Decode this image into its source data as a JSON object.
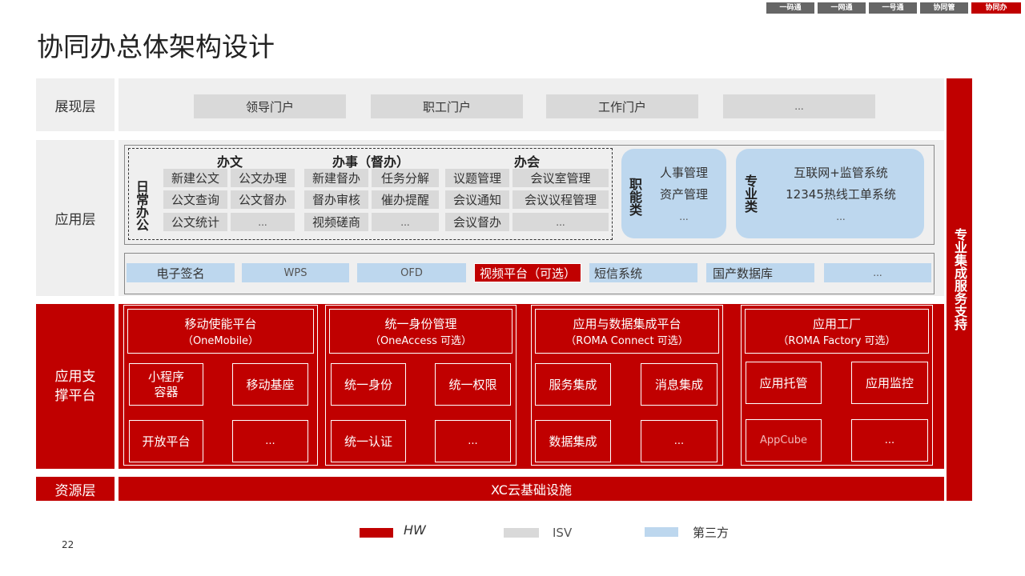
{
  "nav": [
    "一码通",
    "一网通",
    "一号通",
    "协同管",
    "协同办"
  ],
  "title": "协同办总体架构设计",
  "page_number": "22",
  "layers": {
    "presentation": "展现层",
    "application": "应用层",
    "support": "应用支撑平台",
    "resource": "资源层"
  },
  "portals": [
    "领导门户",
    "职工门户",
    "工作门户",
    "..."
  ],
  "daily_office": {
    "label": "日常办公",
    "groups": [
      {
        "header": "办文",
        "items": [
          "新建公文",
          "公文办理",
          "公文查询",
          "公文督办",
          "公文统计",
          "..."
        ]
      },
      {
        "header": "办事（督办）",
        "items": [
          "新建督办",
          "任务分解",
          "督办审核",
          "催办提醒",
          "视频磋商",
          "..."
        ]
      },
      {
        "header": "办会",
        "items": [
          "议题管理",
          "会议室管理",
          "会议通知",
          "会议议程管理",
          "会议督办",
          "..."
        ]
      }
    ]
  },
  "functional": {
    "label": "职能类",
    "items": [
      "人事管理",
      "资产管理",
      "..."
    ]
  },
  "professional": {
    "label": "专业类",
    "items": [
      "互联网+监管系统",
      "12345热线工单系统",
      "..."
    ]
  },
  "components": [
    "电子签名",
    "WPS",
    "OFD",
    "视频平台（可选）",
    "短信系统",
    "国产数据库",
    "..."
  ],
  "platforms": [
    {
      "title": "移动使能平台",
      "subtitle": "（OneMobile）",
      "items": [
        "小程序\n容器",
        "移动基座",
        "开放平台",
        "..."
      ]
    },
    {
      "title": "统一身份管理",
      "subtitle": "（OneAccess 可选）",
      "items": [
        "统一身份",
        "统一权限",
        "统一认证",
        "..."
      ]
    },
    {
      "title": "应用与数据集成平台",
      "subtitle": "（ROMA Connect 可选）",
      "items": [
        "服务集成",
        "消息集成",
        "数据集成",
        "..."
      ]
    },
    {
      "title": "应用工厂",
      "subtitle": "（ROMA Factory 可选）",
      "items": [
        "应用托管",
        "应用监控",
        "AppCube",
        "..."
      ]
    }
  ],
  "infrastructure": "XC云基础设施",
  "side_bar": "专业集成服务支持",
  "legend": [
    {
      "label": "HW",
      "color": "#c00000"
    },
    {
      "label": "ISV",
      "color": "#d9d9d9"
    },
    {
      "label": "第三方",
      "color": "#bdd7ee"
    }
  ]
}
